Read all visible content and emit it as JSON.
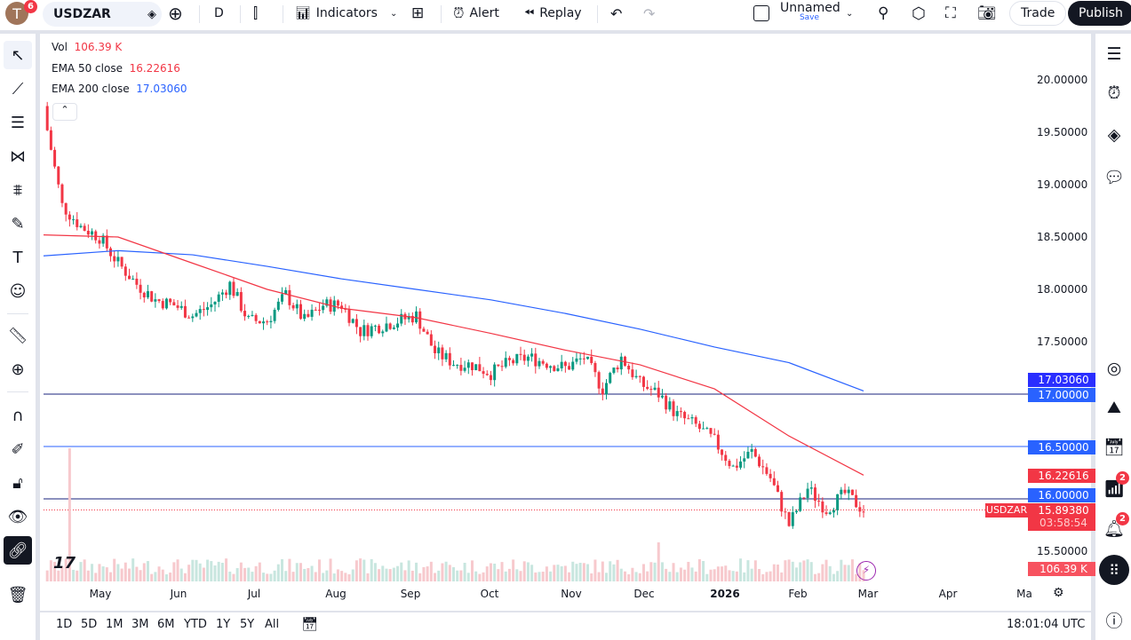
{
  "topbar": {
    "avatar_letter": "T",
    "avatar_badge": "6",
    "symbol": "USDZAR",
    "interval": "D",
    "indicators": "Indicators",
    "alert": "Alert",
    "replay": "Replay",
    "layout_name": "Unnamed",
    "layout_save": "Save",
    "trade": "Trade",
    "publish": "Publish"
  },
  "legend": {
    "vol_label": "Vol",
    "vol_value": "106.39 K",
    "ema50_label": "EMA 50 close",
    "ema50_value": "16.22616",
    "ema200_label": "EMA 200 close",
    "ema200_value": "17.03060"
  },
  "price_axis": [
    "20.00000",
    "19.50000",
    "19.00000",
    "18.50000",
    "18.00000",
    "17.50000",
    "15.50000"
  ],
  "price_labels": {
    "ema200": "17.03060",
    "line17": "17.00000",
    "line165": "16.50000",
    "ema50": "16.22616",
    "line16": "16.00000",
    "symbol": "USDZAR",
    "last": "15.89380",
    "countdown": "03:58:54",
    "volume": "106.39 K"
  },
  "time_axis": [
    "May",
    "Jun",
    "Jul",
    "Aug",
    "Sep",
    "Oct",
    "Nov",
    "Dec",
    "2026",
    "Feb",
    "Mar",
    "Apr",
    "Ma"
  ],
  "bottombar": {
    "ranges": [
      "1D",
      "5D",
      "1M",
      "3M",
      "6M",
      "YTD",
      "1Y",
      "5Y",
      "All"
    ],
    "clock": "18:01:04 UTC"
  },
  "right_badges": {
    "feed": "2",
    "alerts": "2"
  },
  "colors": {
    "up": "#089981",
    "down": "#f23645",
    "ema50": "#f23645",
    "ema200": "#2962ff",
    "hline": "#2962ff",
    "hline_dark": "#131722"
  },
  "chart_data": {
    "type": "candlestick",
    "symbol": "USDZAR",
    "interval": "1D",
    "ylim": [
      15.5,
      20.0
    ],
    "weekly_closes": [
      19.7,
      18.8,
      18.6,
      18.5,
      18.25,
      18.05,
      17.9,
      17.85,
      17.75,
      17.85,
      18.05,
      17.7,
      17.7,
      17.95,
      17.7,
      17.85,
      17.85,
      17.6,
      17.65,
      17.7,
      17.75,
      17.4,
      17.3,
      17.28,
      17.2,
      17.3,
      17.35,
      17.3,
      17.25,
      17.35,
      17.05,
      17.35,
      17.1,
      17.0,
      16.8,
      16.7,
      16.55,
      16.3,
      16.45,
      16.2,
      15.75,
      16.1,
      15.9,
      16.05,
      15.8938
    ],
    "ema50_every_4_weeks": [
      18.52,
      18.5,
      18.25,
      18.0,
      17.82,
      17.73,
      17.58,
      17.42,
      17.28,
      17.05,
      16.6,
      16.22616
    ],
    "ema200_every_4_weeks": [
      18.32,
      18.37,
      18.33,
      18.22,
      18.1,
      18.0,
      17.9,
      17.77,
      17.62,
      17.45,
      17.3,
      17.0306
    ],
    "horizontal_lines": [
      17.0,
      16.5,
      16.0
    ],
    "last_price": 15.8938
  }
}
